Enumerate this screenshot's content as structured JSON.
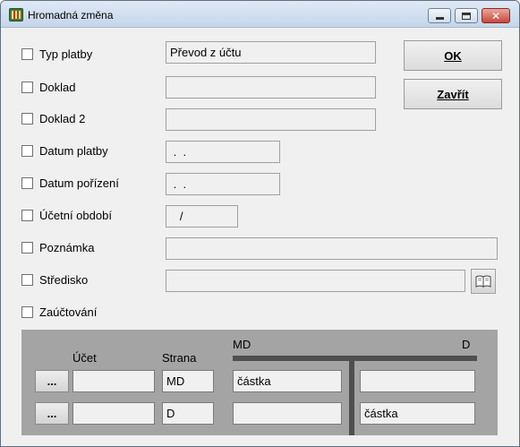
{
  "window": {
    "title": "Hromadná změna",
    "controls": {
      "minimize": "minimize",
      "maximize": "maximize",
      "close": "x"
    }
  },
  "fields": [
    {
      "label": "Typ platby",
      "value": "Převod z účtu"
    },
    {
      "label": "Doklad",
      "value": ""
    },
    {
      "label": "Doklad 2",
      "value": ""
    },
    {
      "label": "Datum platby",
      "value": " .  ."
    },
    {
      "label": "Datum pořízení",
      "value": " .  ."
    },
    {
      "label": "Účetní období",
      "value": "   /"
    },
    {
      "label": "Poznámka",
      "value": ""
    },
    {
      "label": "Středisko",
      "value": ""
    },
    {
      "label": "Zaúčtování"
    }
  ],
  "buttons": {
    "ok": "OK",
    "close": "Zavřít"
  },
  "posting": {
    "headers": {
      "account": "Účet",
      "side": "Strana",
      "md": "MD",
      "d": "D"
    },
    "rows": [
      {
        "browse": "...",
        "account": "",
        "side": "MD",
        "md_value": "částka",
        "d_value": ""
      },
      {
        "browse": "...",
        "account": "",
        "side": "D",
        "md_value": "",
        "d_value": "částka"
      }
    ]
  },
  "icons": {
    "app": "app-icon",
    "lookup": "book-icon"
  }
}
